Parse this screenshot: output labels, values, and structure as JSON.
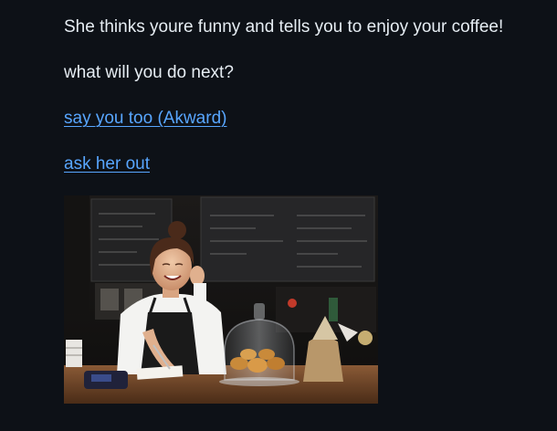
{
  "story": {
    "line1": "She thinks youre funny and tells you to enjoy your coffee!",
    "line2": "what will you do next?"
  },
  "choices": [
    {
      "label": "say you too (Akward)"
    },
    {
      "label": "ask her out"
    }
  ],
  "colors": {
    "background": "#0d1117",
    "text": "#e6edf3",
    "link": "#58a6ff"
  },
  "scene": {
    "board_text": [
      "CAFÉ",
      "MENU",
      "COFFEE"
    ]
  }
}
